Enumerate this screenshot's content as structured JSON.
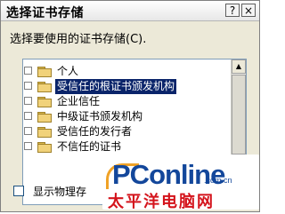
{
  "window": {
    "title": "选择证书存储"
  },
  "titlebar_buttons": {
    "help": "?",
    "close": "×"
  },
  "prompt": "选择要使用的证书存储(C).",
  "tree": {
    "items": [
      {
        "label": "个人",
        "selected": false
      },
      {
        "label": "受信任的根证书颁发机构",
        "selected": true
      },
      {
        "label": "企业信任",
        "selected": false
      },
      {
        "label": "中级证书颁发机构",
        "selected": false
      },
      {
        "label": "受信任的发行者",
        "selected": false
      },
      {
        "label": "不信任的证书",
        "selected": false
      }
    ]
  },
  "scrollbar": {
    "up": "▲"
  },
  "checkbox": {
    "label": "显示物理存"
  },
  "watermark": {
    "brand": "PConline",
    "domain": ".com.cn",
    "chinese": "太平洋电脑网"
  },
  "colors": {
    "selection": "#0a246a",
    "brand_blue": "#13479b",
    "brand_red": "#d4141c"
  }
}
